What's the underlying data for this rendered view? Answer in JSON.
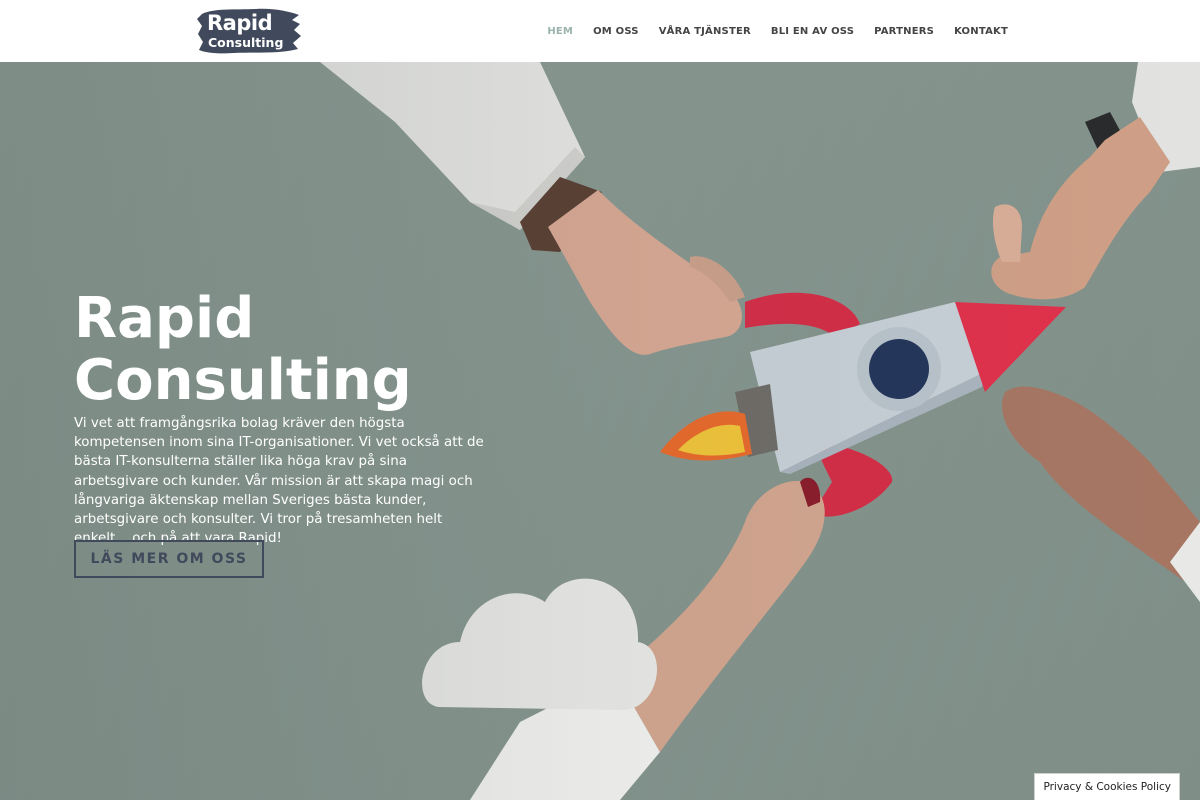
{
  "brand": {
    "line1": "Rapid",
    "line2": "Consulting",
    "color": "#414a5c"
  },
  "nav": {
    "items": [
      {
        "label": "HEM",
        "active": true
      },
      {
        "label": "OM OSS"
      },
      {
        "label": "VÅRA TJÄNSTER"
      },
      {
        "label": "BLI EN AV OSS"
      },
      {
        "label": "PARTNERS"
      },
      {
        "label": "KONTAKT"
      }
    ],
    "active_color": "#9ab3ad"
  },
  "hero": {
    "title_line1": "Rapid",
    "title_line2": "Consulting",
    "body": "Vi vet att framgångsrika bolag kräver den högsta kompetensen inom sina IT-organisationer. Vi vet också att de bästa IT-konsulterna ställer lika höga krav på sina arbetsgivare och kunder. Vår mission är att skapa magi och långvariga äktenskap mellan Sveriges bästa kunder, arbetsgivare och konsulter. Vi tror på tresamheten helt enkelt... och på att vara Rapid!",
    "cta_label": "LÄS MER OM OSS",
    "background_color": "#8a9a91"
  },
  "privacy": {
    "label": "Privacy & Cookies Policy"
  }
}
